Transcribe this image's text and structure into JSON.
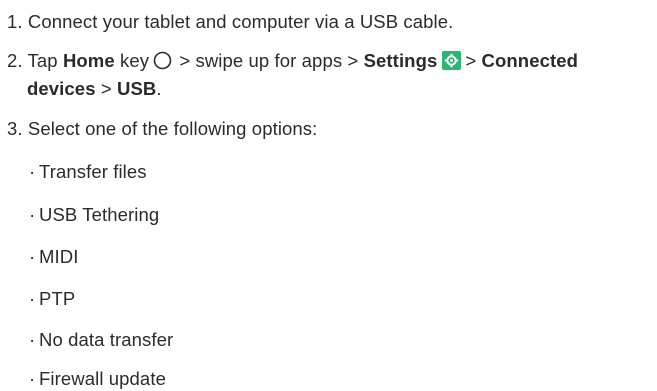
{
  "steps": [
    {
      "number": "1.",
      "text": "Connect your tablet and computer via a USB cable."
    },
    {
      "number": "2.",
      "tap": "Tap",
      "home": "Home",
      "key": "key",
      "swipe": "> swipe up for apps >",
      "settings": "Settings",
      "gt1": ">",
      "connected": "Connected",
      "devices": "devices",
      "gt2": ">",
      "usb": "USB",
      "period": "."
    },
    {
      "number": "3.",
      "text": "Select one of the following options:"
    }
  ],
  "options": [
    "Transfer files",
    "USB Tethering",
    "MIDI",
    "PTP",
    "No data transfer",
    "Firewall update"
  ],
  "bullet": "·",
  "icons": {
    "home_key": "home-circle-icon",
    "settings": "settings-gear-icon",
    "settings_color": "#2bb673"
  }
}
